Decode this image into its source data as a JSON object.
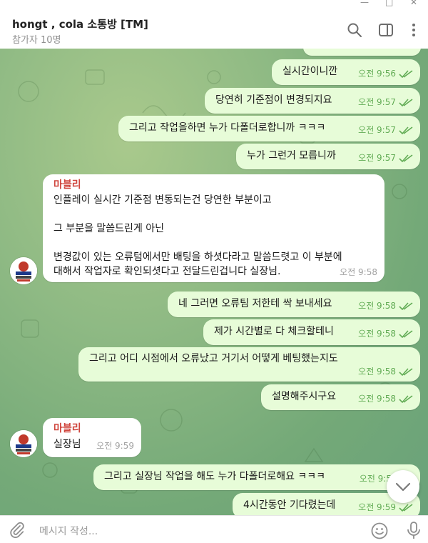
{
  "header": {
    "title": "hongt , cola 소통방 [TM]",
    "subtitle": "참가자 10명",
    "icons": [
      "search-icon",
      "sidebar-toggle-icon",
      "more-vert-icon"
    ]
  },
  "window_controls": [
    "minimize-icon",
    "maximize-icon",
    "close-icon"
  ],
  "messages": [
    {
      "dir": "out",
      "text": "실시간이니깐",
      "time": "오전 9:56",
      "status": "read"
    },
    {
      "dir": "out",
      "text": "당연히 기준점이 변경되지요",
      "time": "오전 9:57",
      "status": "read"
    },
    {
      "dir": "out",
      "text": "그리고 작업을하면 누가 다폴더로합니까 ㅋㅋㅋ",
      "time": "오전 9:57",
      "status": "read"
    },
    {
      "dir": "out",
      "text": "누가 그런거 모릅니까",
      "time": "오전 9:57",
      "status": "read"
    },
    {
      "dir": "in",
      "sender": "마블리",
      "lines": [
        "인플레이 실시간 기준점 변동되는건 당연한 부분이고",
        "",
        "그 부분을 말씀드린게 아닌",
        "",
        "변경값이 있는 오류텀에서만 배팅을 하셧다라고 말씀드렷고 이 부분에",
        "대해서 작업자로 확인되셧다고 전달드린겁니다 실장님."
      ],
      "time": "오전 9:58"
    },
    {
      "dir": "out",
      "text": "네 그러면 오류팀 저한테 싹 보내세요",
      "time": "오전 9:58",
      "status": "read"
    },
    {
      "dir": "out",
      "text": "제가 시간별로 다 체크할테니",
      "time": "오전 9:58",
      "status": "read"
    },
    {
      "dir": "out",
      "text": "그리고 어디 시점에서 오류났고 거기서 어떻게 베팅했는지도",
      "time": "오전 9:58",
      "status": "read"
    },
    {
      "dir": "out",
      "text": "설명해주시구요",
      "time": "오전 9:58",
      "status": "read"
    },
    {
      "dir": "in",
      "sender": "마블리",
      "text": "실장님",
      "time": "오전 9:59"
    },
    {
      "dir": "out",
      "text": "그리고 실장님 작업을 해도 누가 다폴더로해요 ㅋㅋㅋ",
      "time": "오전 9:5",
      "status": "read"
    },
    {
      "dir": "out",
      "text": "4시간동안 기다렸는데",
      "time": "오전 9:59",
      "status": "read"
    }
  ],
  "composer": {
    "placeholder": "메시지 작성...",
    "icons": [
      "attach-icon",
      "emoji-icon",
      "mic-icon"
    ]
  },
  "colors": {
    "outgoing_bubble": "#e7fcd8",
    "incoming_bubble": "#ffffff",
    "read_check": "#62ac55",
    "sender_name": "#d0473f"
  }
}
